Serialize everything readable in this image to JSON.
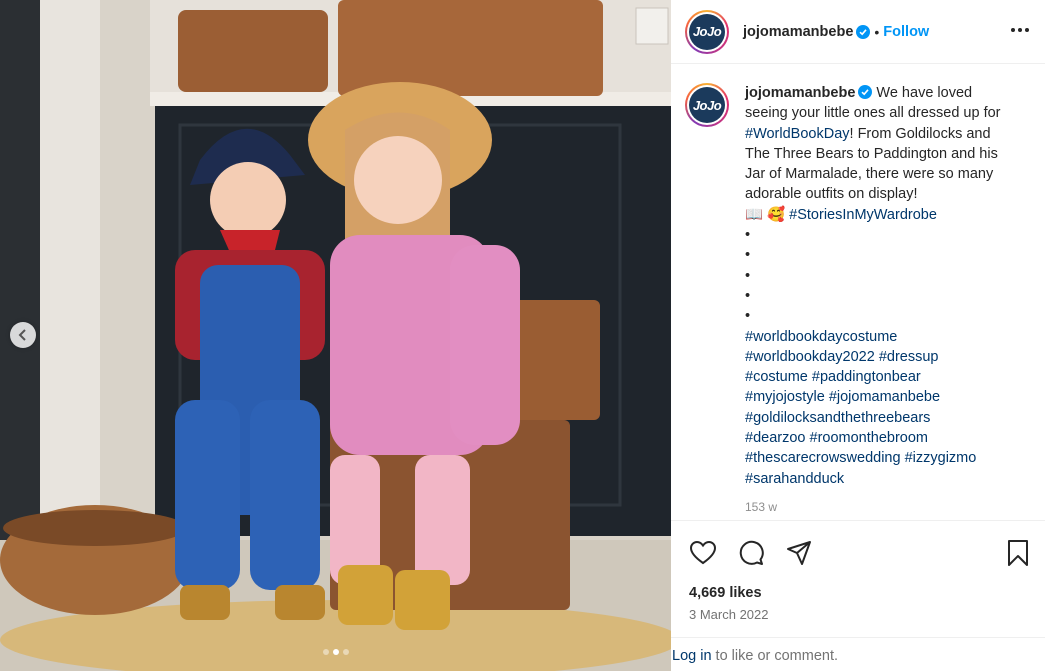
{
  "post": {
    "username": "jojomamanbebe",
    "avatar_text": "JoJo",
    "follow_label": "Follow",
    "separator": "•"
  },
  "caption": {
    "text_a": " We have loved seeing your little ones all dressed up for ",
    "tag_worldbookday": "#WorldBookDay",
    "text_b": "! From Goldilocks and The Three Bears to Paddington and his Jar of Marmalade, there were so many adorable outfits on display!",
    "emojis": "📖 🥰 ",
    "tag_stories": "#StoriesInMyWardrobe",
    "bullets": [
      "•",
      "•",
      "•",
      "•",
      "•"
    ],
    "hashtags": [
      "#worldbookdaycostume",
      "#worldbookday2022",
      "#dressup",
      "#costume",
      "#paddingtonbear",
      "#myjojostyle",
      "#jojomamanbebe",
      "#goldilocksandthethreebears",
      "#dearzoo",
      "#roomonthebroom",
      "#thescarecrowswedding",
      "#izzygizmo",
      "#sarahandduck"
    ],
    "age": "153 w"
  },
  "engagement": {
    "likes": "4,669 likes",
    "date": "3 March 2022"
  },
  "login": {
    "link_text": "Log in",
    "rest_text": " to like or comment."
  },
  "carousel": {
    "slide_count": 3,
    "active_index": 1
  },
  "icons": {
    "verified": "verified-badge-icon",
    "more": "more-options-icon",
    "like": "heart-icon",
    "comment": "comment-icon",
    "share": "share-icon",
    "save": "bookmark-icon",
    "prev": "chevron-left-icon"
  },
  "colors": {
    "link_blue": "#0095f6",
    "hashtag": "#00376b",
    "verified": "#0095f6",
    "avatar_bg": "#1b3a5c",
    "muted": "#737373"
  }
}
